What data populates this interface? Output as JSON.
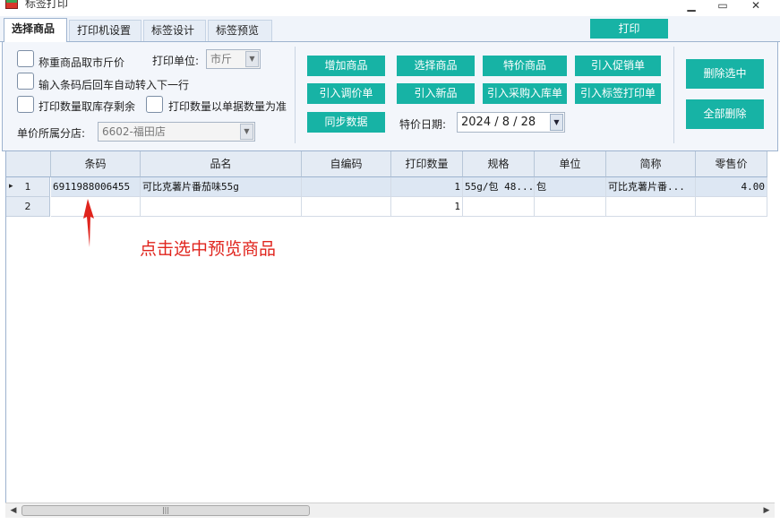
{
  "window": {
    "title": "标签打印",
    "minimize": "▁",
    "maximize": "▭",
    "close": "✕"
  },
  "tabs": [
    {
      "label": "选择商品"
    },
    {
      "label": "打印机设置"
    },
    {
      "label": "标签设计"
    },
    {
      "label": "标签预览"
    }
  ],
  "print_button": "打印",
  "options": {
    "weigh_price_label": "称重商品取市斤价",
    "print_unit_label": "打印单位:",
    "print_unit_value": "市斤",
    "auto_next_row_label": "输入条码后回车自动转入下一行",
    "qty_from_stock_label": "打印数量取库存剩余",
    "qty_from_doc_label": "打印数量以单据数量为准",
    "branch_label": "单价所属分店:",
    "branch_value": "6602-福田店"
  },
  "actions": {
    "add_goods": "增加商品",
    "select_goods": "选择商品",
    "special_goods": "特价商品",
    "import_promo": "引入促销单",
    "import_price_adjust": "引入调价单",
    "import_new": "引入新品",
    "import_purchase": "引入采购入库单",
    "import_label_print": "引入标签打印单",
    "sync_data": "同步数据",
    "special_date_label": "特价日期:",
    "special_date_value": "2024 / 8 / 28",
    "delete_selected": "删除选中",
    "delete_all": "全部删除"
  },
  "table": {
    "columns": [
      "条码",
      "品名",
      "自编码",
      "打印数量",
      "规格",
      "单位",
      "简称",
      "零售价"
    ],
    "rows": [
      {
        "index": "1",
        "marker": "▸",
        "barcode": "6911988006455",
        "name": "可比克薯片番茄味55g",
        "self_code": "",
        "qty": "1",
        "spec": "55g/包 48...",
        "unit": "包",
        "short_name": "可比克薯片番...",
        "price": "4.00"
      },
      {
        "index": "2",
        "marker": "",
        "barcode": "",
        "name": "",
        "self_code": "",
        "qty": "1",
        "spec": "",
        "unit": "",
        "short_name": "",
        "price": ""
      }
    ]
  },
  "annotation": "点击选中预览商品",
  "scrollbar": {
    "left_arrow": "◀",
    "right_arrow": "▶",
    "thumb_grip": "|||"
  },
  "colors": {
    "button": "#17b3a5",
    "annotation": "#e0241d",
    "header": "#e4ebf4"
  }
}
